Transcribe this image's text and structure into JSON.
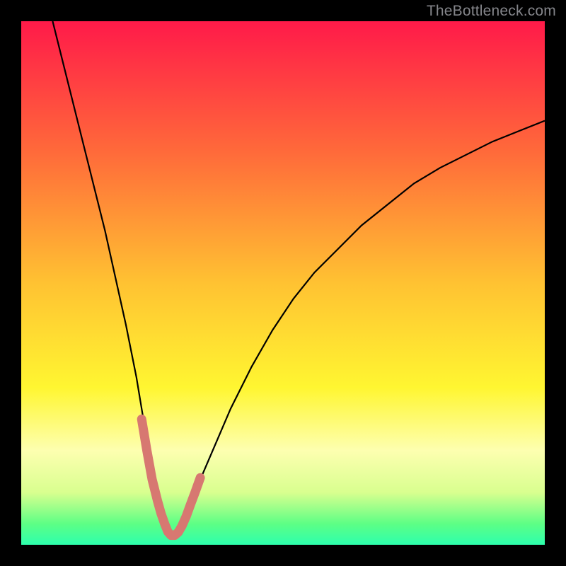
{
  "attribution": "TheBottleneck.com",
  "chart_data": {
    "type": "line",
    "title": "",
    "xlabel": "",
    "ylabel": "",
    "xlim": [
      0,
      100
    ],
    "ylim": [
      0,
      100
    ],
    "grid": false,
    "legend": false,
    "notes": "Single black curve plunging from top-left toward a minimum near x≈28 and rising to the right. Around the minimum the curve is overdrawn with a thick salmon stroke. A narrow green band and a pale-yellow band are drawn near the bottom of the plot area. Values are estimated from pixel positions; axes are unlabeled.",
    "background_gradient_stops": [
      {
        "offset": 0.0,
        "color": "#ff1a49"
      },
      {
        "offset": 0.25,
        "color": "#ff6a3a"
      },
      {
        "offset": 0.5,
        "color": "#ffc232"
      },
      {
        "offset": 0.7,
        "color": "#fff631"
      },
      {
        "offset": 0.82,
        "color": "#fdffb0"
      },
      {
        "offset": 0.9,
        "color": "#d9ff8f"
      },
      {
        "offset": 0.96,
        "color": "#5dff85"
      },
      {
        "offset": 1.0,
        "color": "#2dffad"
      }
    ],
    "series": [
      {
        "name": "curve",
        "color": "#000000",
        "x": [
          6,
          8,
          10,
          12,
          14,
          16,
          18,
          20,
          22,
          24,
          25,
          26,
          27,
          28,
          29,
          30,
          31,
          32,
          34,
          37,
          40,
          44,
          48,
          52,
          56,
          60,
          65,
          70,
          75,
          80,
          85,
          90,
          95,
          100
        ],
        "y": [
          100,
          92,
          84,
          76,
          68,
          60,
          51,
          42,
          32,
          20,
          14,
          9,
          5,
          2,
          1.5,
          2,
          4,
          7,
          12,
          19,
          26,
          34,
          41,
          47,
          52,
          56,
          61,
          65,
          69,
          72,
          74.5,
          77,
          79,
          81
        ]
      }
    ],
    "highlight": {
      "name": "minimum-region",
      "color": "#d77871",
      "x": [
        23,
        24,
        25,
        26,
        26.7,
        27.4,
        28,
        28.6,
        29.3,
        30,
        30.7,
        31.5,
        32.3,
        33.2,
        34.2
      ],
      "y": [
        24,
        18,
        12.5,
        8.5,
        6,
        4,
        2.5,
        1.8,
        1.8,
        2.4,
        3.6,
        5.4,
        7.6,
        10,
        12.8
      ]
    },
    "bands": [
      {
        "name": "pale-yellow-band",
        "y_from": 14,
        "y_to": 19,
        "color": "#fdffb0"
      },
      {
        "name": "green-band",
        "y_from": 0,
        "y_to": 4,
        "color": "#3dff96"
      }
    ]
  }
}
